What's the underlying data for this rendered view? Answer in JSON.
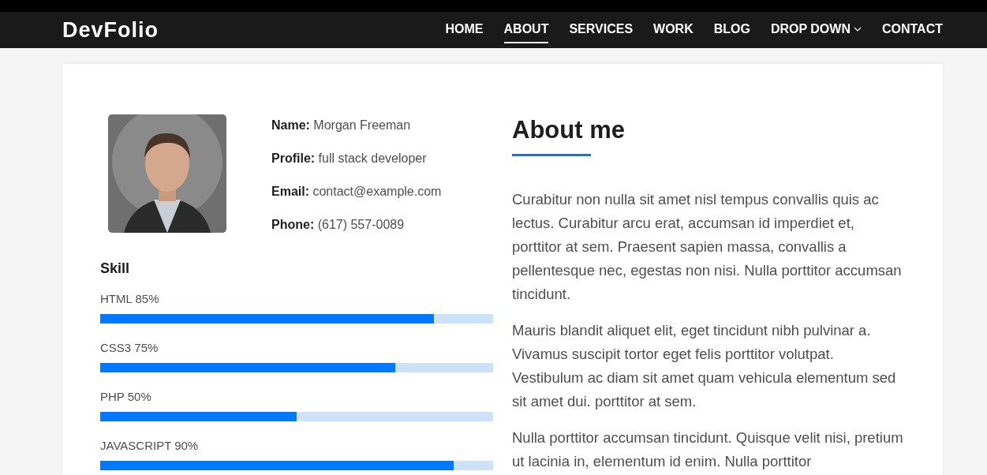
{
  "brand": "DevFolio",
  "nav": [
    {
      "label": "HOME",
      "selected": false,
      "kind": "link"
    },
    {
      "label": "ABOUT",
      "selected": true,
      "kind": "link"
    },
    {
      "label": "SERVICES",
      "selected": false,
      "kind": "link"
    },
    {
      "label": "WORK",
      "selected": false,
      "kind": "link"
    },
    {
      "label": "BLOG",
      "selected": false,
      "kind": "link"
    },
    {
      "label": "DROP DOWN",
      "selected": false,
      "kind": "dropdown"
    },
    {
      "label": "CONTACT",
      "selected": false,
      "kind": "link"
    }
  ],
  "profile": {
    "fields": [
      {
        "label": "Name:",
        "value": "Morgan Freeman"
      },
      {
        "label": "Profile:",
        "value": "full stack developer"
      },
      {
        "label": "Email:",
        "value": "contact@example.com"
      },
      {
        "label": "Phone:",
        "value": "(617) 557-0089"
      }
    ]
  },
  "skills": {
    "title": "Skill",
    "items": [
      {
        "label": "HTML 85%",
        "level": 0.85
      },
      {
        "label": "CSS3 75%",
        "level": 0.75
      },
      {
        "label": "PHP 50%",
        "level": 0.5
      },
      {
        "label": "JAVASCRIPT 90%",
        "level": 0.9
      }
    ]
  },
  "about": {
    "title": "About me",
    "paragraphs": [
      "Curabitur non nulla sit amet nisl tempus convallis quis ac lectus. Curabitur arcu erat, accumsan id imperdiet et, porttitor at sem. Praesent sapien massa, convallis a pellentesque nec, egestas non nisi. Nulla porttitor accumsan tincidunt.",
      "Mauris blandit aliquet elit, eget tincidunt nibh pulvinar a. Vivamus suscipit tortor eget felis porttitor volutpat. Vestibulum ac diam sit amet quam vehicula elementum sed sit amet dui. porttitor at sem.",
      "Nulla porttitor accumsan tincidunt. Quisque velit nisi, pretium ut lacinia in, elementum id enim. Nulla porttitor"
    ]
  }
}
